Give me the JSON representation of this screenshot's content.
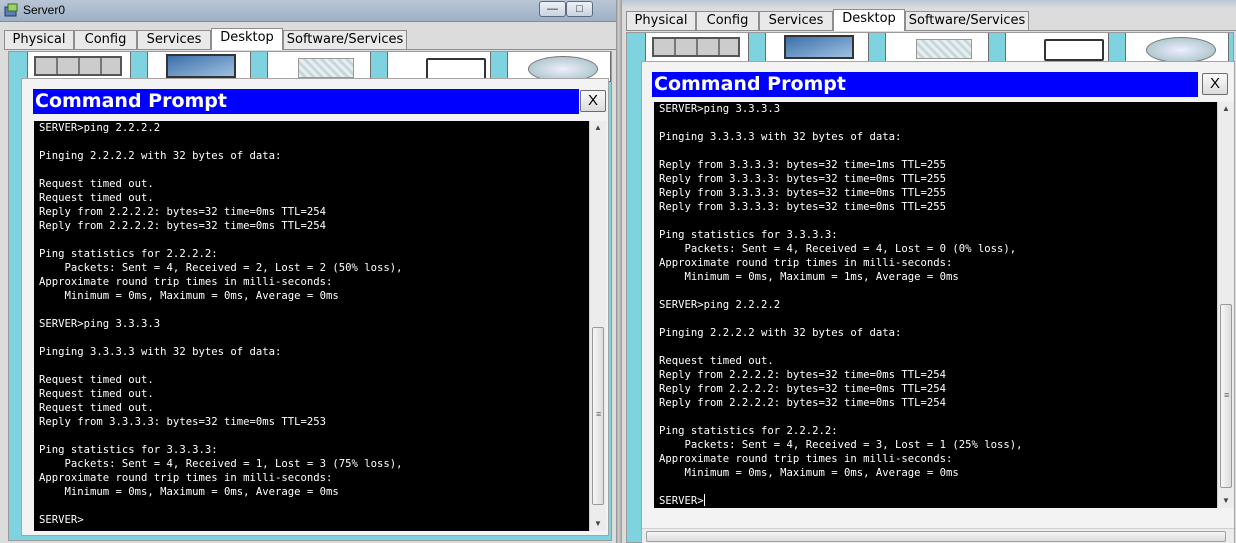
{
  "left_window": {
    "title": "Server0",
    "minimize_glyph": "—",
    "maximize_glyph": "□",
    "tabs": [
      "Physical",
      "Config",
      "Services",
      "Desktop",
      "Software/Services"
    ],
    "active_tab": "Desktop",
    "desktop_icons": [
      "ip-config-icon",
      "dial-up-icon",
      "terminal-icon",
      "command-prompt-icon",
      "web-browser-icon"
    ],
    "cmd": {
      "title": "Command Prompt",
      "close_label": "X",
      "lines": [
        "SERVER>ping 2.2.2.2",
        "",
        "Pinging 2.2.2.2 with 32 bytes of data:",
        "",
        "Request timed out.",
        "Request timed out.",
        "Reply from 2.2.2.2: bytes=32 time=0ms TTL=254",
        "Reply from 2.2.2.2: bytes=32 time=0ms TTL=254",
        "",
        "Ping statistics for 2.2.2.2:",
        "    Packets: Sent = 4, Received = 2, Lost = 2 (50% loss),",
        "Approximate round trip times in milli-seconds:",
        "    Minimum = 0ms, Maximum = 0ms, Average = 0ms",
        "",
        "SERVER>ping 3.3.3.3",
        "",
        "Pinging 3.3.3.3 with 32 bytes of data:",
        "",
        "Request timed out.",
        "Request timed out.",
        "Request timed out.",
        "Reply from 3.3.3.3: bytes=32 time=0ms TTL=253",
        "",
        "Ping statistics for 3.3.3.3:",
        "    Packets: Sent = 4, Received = 1, Lost = 3 (75% loss),",
        "Approximate round trip times in milli-seconds:",
        "    Minimum = 0ms, Maximum = 0ms, Average = 0ms",
        "",
        "SERVER>"
      ]
    }
  },
  "right_window": {
    "tabs": [
      "Physical",
      "Config",
      "Services",
      "Desktop",
      "Software/Services"
    ],
    "active_tab": "Desktop",
    "desktop_icons": [
      "ip-config-icon",
      "dial-up-icon",
      "terminal-icon",
      "command-prompt-icon",
      "web-browser-icon"
    ],
    "cmd": {
      "title": "Command Prompt",
      "close_label": "X",
      "lines": [
        "SERVER>ping 3.3.3.3",
        "",
        "Pinging 3.3.3.3 with 32 bytes of data:",
        "",
        "Reply from 3.3.3.3: bytes=32 time=1ms TTL=255",
        "Reply from 3.3.3.3: bytes=32 time=0ms TTL=255",
        "Reply from 3.3.3.3: bytes=32 time=0ms TTL=255",
        "Reply from 3.3.3.3: bytes=32 time=0ms TTL=255",
        "",
        "Ping statistics for 3.3.3.3:",
        "    Packets: Sent = 4, Received = 4, Lost = 0 (0% loss),",
        "Approximate round trip times in milli-seconds:",
        "    Minimum = 0ms, Maximum = 1ms, Average = 0ms",
        "",
        "SERVER>ping 2.2.2.2",
        "",
        "Pinging 2.2.2.2 with 32 bytes of data:",
        "",
        "Request timed out.",
        "Reply from 2.2.2.2: bytes=32 time=0ms TTL=254",
        "Reply from 2.2.2.2: bytes=32 time=0ms TTL=254",
        "Reply from 2.2.2.2: bytes=32 time=0ms TTL=254",
        "",
        "Ping statistics for 2.2.2.2:",
        "    Packets: Sent = 4, Received = 3, Lost = 1 (25% loss),",
        "Approximate round trip times in milli-seconds:",
        "    Minimum = 0ms, Maximum = 0ms, Average = 0ms",
        "",
        "SERVER>"
      ]
    }
  },
  "colors": {
    "cmd_title_bg": "#0000ff",
    "desktop_bg": "#7fd3e0",
    "terminal_bg": "#000000",
    "terminal_fg": "#ffffff"
  }
}
